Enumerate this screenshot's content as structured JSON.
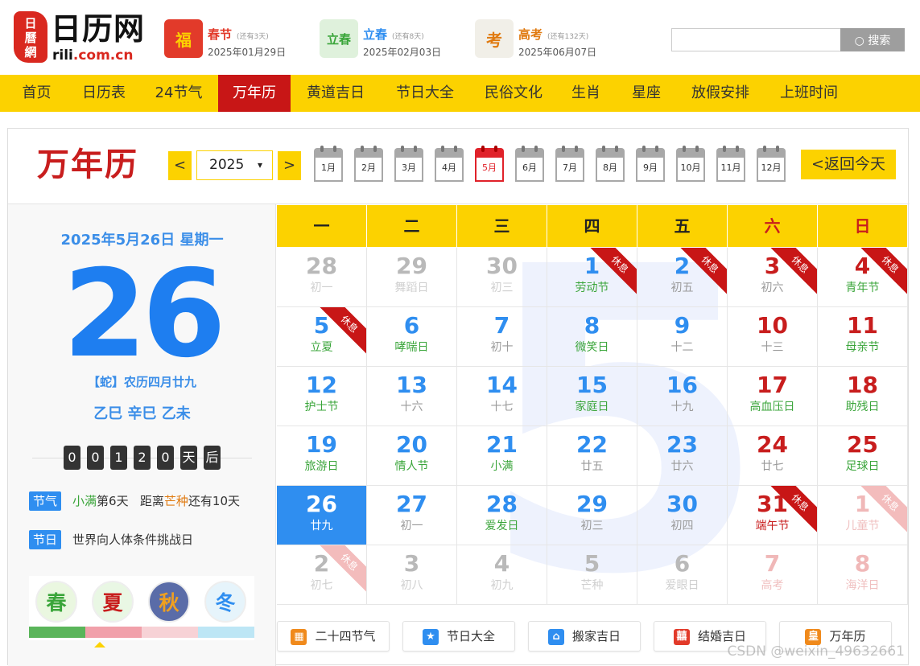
{
  "logo": {
    "seal": "日\n曆\n網",
    "name": "日历网",
    "url_pre": "rili",
    "url_post": ".com.cn"
  },
  "festivals": [
    {
      "name": "春节",
      "remain": "(还有3天)",
      "date": "2025年01月29日",
      "color": "#e23a2a",
      "icon_text": "福"
    },
    {
      "name": "立春",
      "remain": "(还有8天)",
      "date": "2025年02月03日",
      "color": "#2f8ef0",
      "icon_text": "立春"
    },
    {
      "name": "高考",
      "remain": "(还有132天)",
      "date": "2025年06月07日",
      "color": "#e07a10",
      "icon_text": "考"
    }
  ],
  "search": {
    "placeholder": "",
    "button": "搜索"
  },
  "nav": [
    "首页",
    "日历表",
    "24节气",
    "万年历",
    "黄道吉日",
    "节日大全",
    "民俗文化",
    "生肖",
    "星座",
    "放假安排",
    "上班时间"
  ],
  "nav_active": 3,
  "toolbar": {
    "title": "万年历",
    "prev": "<",
    "next": ">",
    "year": "2025",
    "today": "<返回今天"
  },
  "months": [
    "1月",
    "2月",
    "3月",
    "4月",
    "5月",
    "6月",
    "7月",
    "8月",
    "9月",
    "10月",
    "11月",
    "12月"
  ],
  "month_active": 4,
  "selected": {
    "date_line": "2025年5月26日 星期一",
    "day": "26",
    "lunar": "【蛇】农历四月廿九",
    "ganzhi": "乙巳 辛巳 乙未",
    "countdown": [
      "0",
      "0",
      "1",
      "2",
      "0",
      "天",
      "后"
    ],
    "jieqi_tag": "节气",
    "jieqi_a": "小满",
    "jieqi_b": "第6天",
    "jieqi_c": "距离",
    "jieqi_d": "芒种",
    "jieqi_e": "还有10天",
    "jieri_tag": "节日",
    "jieri": "世界向人体条件挑战日",
    "seasons": [
      "春",
      "夏",
      "秋",
      "冬"
    ]
  },
  "weekdays": [
    "一",
    "二",
    "三",
    "四",
    "五",
    "六",
    "日"
  ],
  "watermark_digit": "5",
  "days": [
    {
      "n": "28",
      "s": "初一",
      "st": "other"
    },
    {
      "n": "29",
      "s": "舞蹈日",
      "st": "other"
    },
    {
      "n": "30",
      "s": "初三",
      "st": "other"
    },
    {
      "n": "1",
      "s": "劳动节",
      "st": "holiday",
      "sc": "green",
      "rib": "休息"
    },
    {
      "n": "2",
      "s": "初五",
      "st": "blue",
      "rib": "休息"
    },
    {
      "n": "3",
      "s": "初六",
      "st": "red",
      "rib": "休息"
    },
    {
      "n": "4",
      "s": "青年节",
      "st": "red",
      "sc": "green",
      "rib": "休息"
    },
    {
      "n": "5",
      "s": "立夏",
      "st": "blue",
      "sc": "green",
      "rib": "休息"
    },
    {
      "n": "6",
      "s": "哮喘日",
      "st": "blue",
      "sc": "green"
    },
    {
      "n": "7",
      "s": "初十",
      "st": "blue"
    },
    {
      "n": "8",
      "s": "微笑日",
      "st": "blue",
      "sc": "green"
    },
    {
      "n": "9",
      "s": "十二",
      "st": "blue"
    },
    {
      "n": "10",
      "s": "十三",
      "st": "red"
    },
    {
      "n": "11",
      "s": "母亲节",
      "st": "red",
      "sc": "green"
    },
    {
      "n": "12",
      "s": "护士节",
      "st": "blue",
      "sc": "green"
    },
    {
      "n": "13",
      "s": "十六",
      "st": "blue"
    },
    {
      "n": "14",
      "s": "十七",
      "st": "blue"
    },
    {
      "n": "15",
      "s": "家庭日",
      "st": "blue",
      "sc": "green"
    },
    {
      "n": "16",
      "s": "十九",
      "st": "blue"
    },
    {
      "n": "17",
      "s": "高血压日",
      "st": "red",
      "sc": "green"
    },
    {
      "n": "18",
      "s": "助残日",
      "st": "red",
      "sc": "green"
    },
    {
      "n": "19",
      "s": "旅游日",
      "st": "blue",
      "sc": "green"
    },
    {
      "n": "20",
      "s": "情人节",
      "st": "blue",
      "sc": "green"
    },
    {
      "n": "21",
      "s": "小满",
      "st": "blue",
      "sc": "green"
    },
    {
      "n": "22",
      "s": "廿五",
      "st": "blue"
    },
    {
      "n": "23",
      "s": "廿六",
      "st": "blue"
    },
    {
      "n": "24",
      "s": "廿七",
      "st": "red"
    },
    {
      "n": "25",
      "s": "足球日",
      "st": "red",
      "sc": "green"
    },
    {
      "n": "26",
      "s": "廿九",
      "st": "sel"
    },
    {
      "n": "27",
      "s": "初一",
      "st": "blue"
    },
    {
      "n": "28",
      "s": "爱发日",
      "st": "blue",
      "sc": "green"
    },
    {
      "n": "29",
      "s": "初三",
      "st": "blue"
    },
    {
      "n": "30",
      "s": "初四",
      "st": "blue"
    },
    {
      "n": "31",
      "s": "端午节",
      "st": "red",
      "sc": "red",
      "rib": "休息"
    },
    {
      "n": "1",
      "s": "儿童节",
      "st": "otherred",
      "rib": "休息",
      "ribf": true
    },
    {
      "n": "2",
      "s": "初七",
      "st": "other",
      "rib": "休息",
      "ribf": true
    },
    {
      "n": "3",
      "s": "初八",
      "st": "other"
    },
    {
      "n": "4",
      "s": "初九",
      "st": "other"
    },
    {
      "n": "5",
      "s": "芒种",
      "st": "other"
    },
    {
      "n": "6",
      "s": "爱眼日",
      "st": "other"
    },
    {
      "n": "7",
      "s": "高考",
      "st": "otherred"
    },
    {
      "n": "8",
      "s": "海洋日",
      "st": "otherred"
    }
  ],
  "quick": [
    {
      "label": "二十四节气",
      "icon": "calendar-icon",
      "color": "#f08a1c"
    },
    {
      "label": "节日大全",
      "icon": "star-icon",
      "color": "#2f8ef0"
    },
    {
      "label": "搬家吉日",
      "icon": "house-icon",
      "color": "#2f8ef0"
    },
    {
      "label": "结婚吉日",
      "icon": "double-happiness-icon",
      "color": "#e23a2a"
    },
    {
      "label": "万年历",
      "icon": "calendar-icon",
      "color": "#f08a1c"
    }
  ],
  "quick_glyphs": [
    "▦",
    "★",
    "⌂",
    "囍",
    "皇"
  ],
  "csdn": "CSDN @weixin_49632661"
}
